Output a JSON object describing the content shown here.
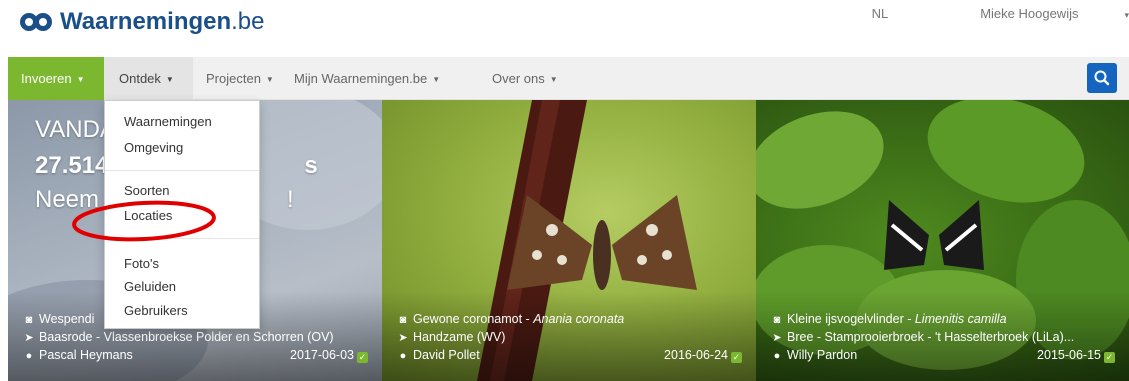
{
  "header": {
    "logo_brand": "Waarnemingen",
    "logo_domain": ".be",
    "language": "NL",
    "user": "Mieke Hoogewijs"
  },
  "nav": {
    "invoeren": "Invoeren",
    "ontdek": "Ontdek",
    "projecten": "Projecten",
    "mijn": "Mijn Waarnemingen.be",
    "over": "Over ons"
  },
  "dropdown": {
    "items": [
      "Waarnemingen",
      "Omgeving",
      "Soorten",
      "Locaties",
      "Foto's",
      "Geluiden",
      "Gebruikers"
    ]
  },
  "hero": {
    "line1": "VANDA",
    "line2": "27.514",
    "line2_suffix": "s",
    "line3": "Neem",
    "line3_suffix": "!"
  },
  "photos": [
    {
      "species": "Wespendi",
      "species_latin": "",
      "location": "Baasrode - Vlassenbroekse Polder en Schorren (OV)",
      "observer": "Pascal Heymans",
      "date": "2017-06-03"
    },
    {
      "species": "Gewone coronamot - ",
      "species_latin": "Anania coronata",
      "location": "Handzame (WV)",
      "observer": "David Pollet",
      "date": "2016-06-24"
    },
    {
      "species": "Kleine ijsvogelvlinder - ",
      "species_latin": "Limenitis camilla",
      "location": "Bree - Stamprooierbroek - 't Hasselterbroek (LiLa)...",
      "observer": "Willy Pardon",
      "date": "2015-06-15"
    }
  ],
  "colors": {
    "brand_blue": "#1a4f8a",
    "invoeren_green": "#7cb82f",
    "search_blue": "#1565c0",
    "annotation_red": "#e00000"
  },
  "icons": [
    "logo-icon",
    "camera-icon",
    "location-arrow-icon",
    "user-icon",
    "check-icon",
    "search-icon",
    "caret-down-icon"
  ]
}
